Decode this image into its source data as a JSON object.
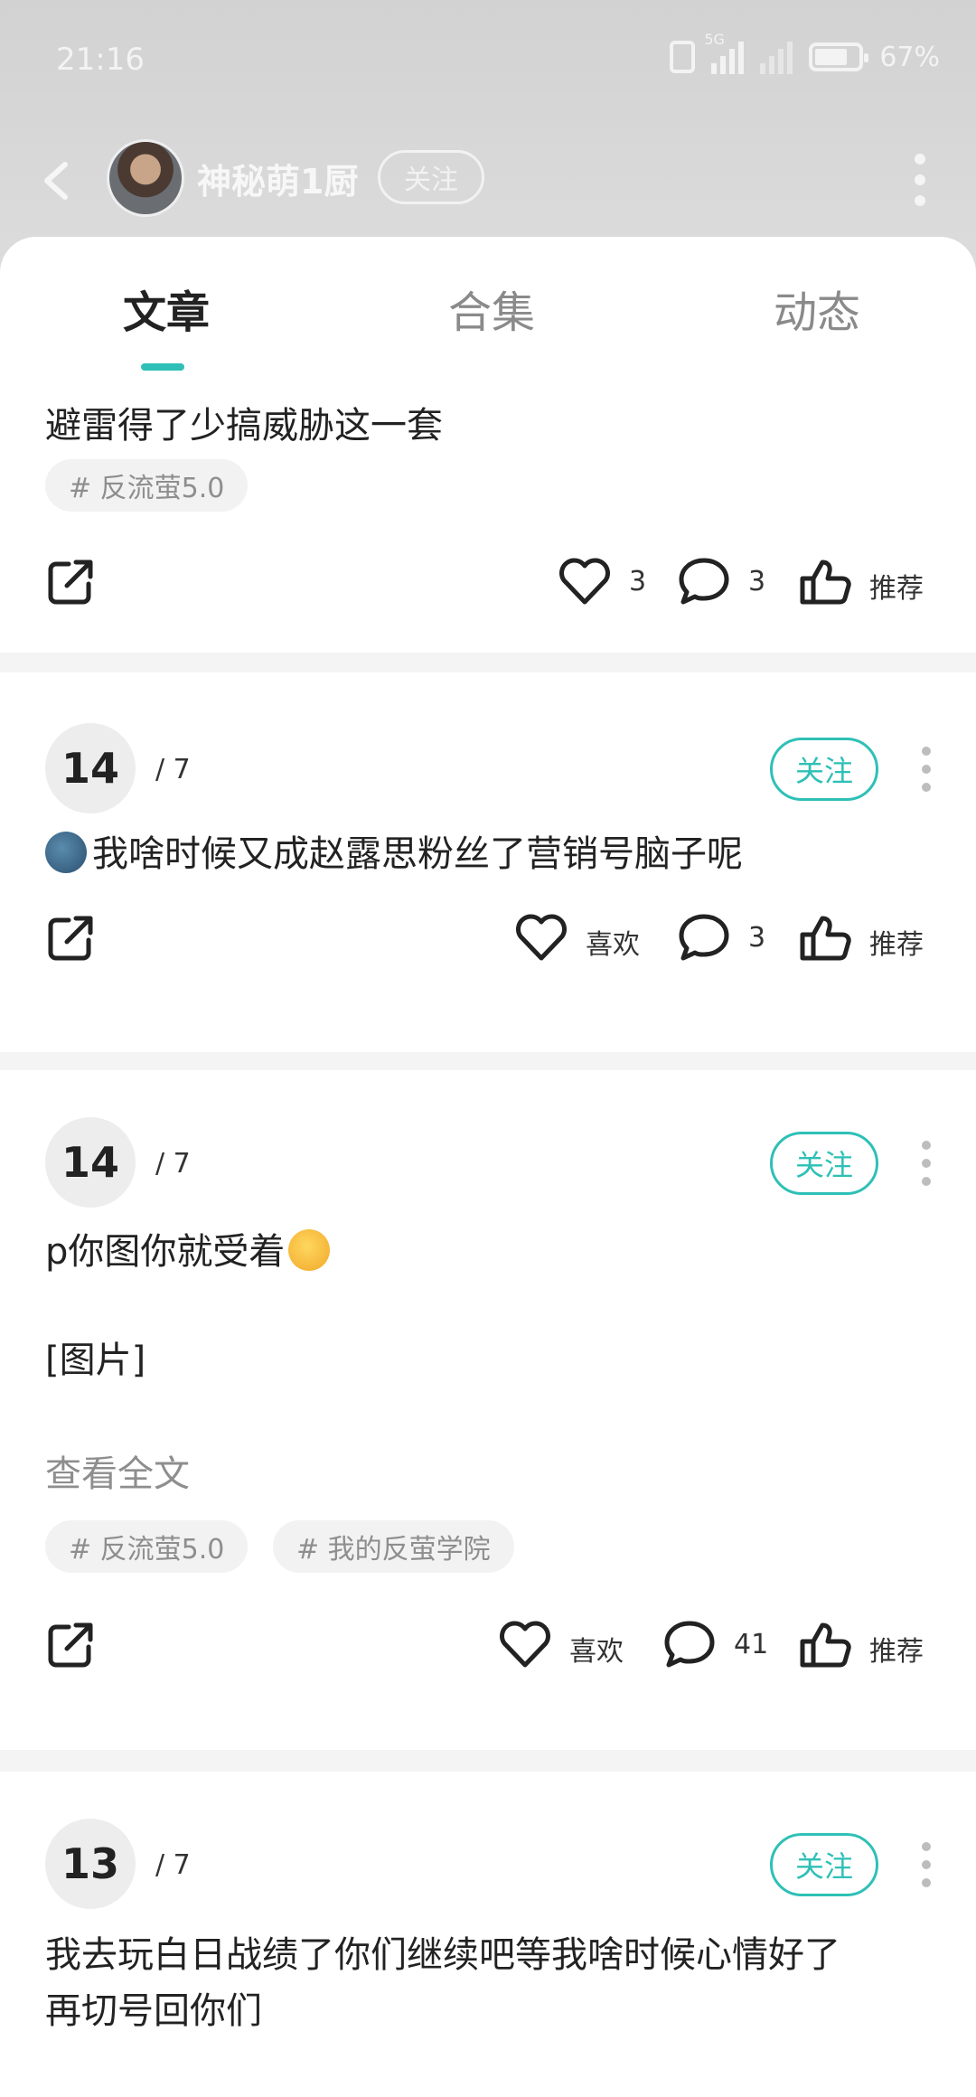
{
  "status_bar": {
    "time": "21:16",
    "network": "5G",
    "battery": "67%"
  },
  "header": {
    "username": "神秘萌1厨",
    "follow_label": "关注"
  },
  "tabs": [
    {
      "label": "文章",
      "active": true
    },
    {
      "label": "合集",
      "active": false
    },
    {
      "label": "动态",
      "active": false
    }
  ],
  "posts": [
    {
      "text": "避雷得了少搞威胁这一套",
      "tags": [
        "# 反流萤5.0"
      ],
      "likes": "3",
      "comments": "3",
      "recommend_label": "推荐"
    },
    {
      "rank": "14",
      "rank_total": "/ 7",
      "follow_label": "关注",
      "text": "我啥时候又成赵露思粉丝了营销号脑子呢",
      "like_label": "喜欢",
      "comments": "3",
      "recommend_label": "推荐"
    },
    {
      "rank": "14",
      "rank_total": "/ 7",
      "follow_label": "关注",
      "text": "p你图你就受着",
      "image_placeholder": "[图片]",
      "read_more": "查看全文",
      "tags": [
        "# 反流萤5.0",
        "# 我的反萤学院"
      ],
      "like_label": "喜欢",
      "comments": "41",
      "recommend_label": "推荐"
    },
    {
      "rank": "13",
      "rank_total": "/ 7",
      "follow_label": "关注",
      "text_line1": "我去玩白日战绩了你们继续吧等我啥时候心情好了",
      "text_line2": "再切号回你们"
    }
  ],
  "colors": {
    "accent": "#2ec0b6",
    "header_bg": "#d2d2d2"
  }
}
